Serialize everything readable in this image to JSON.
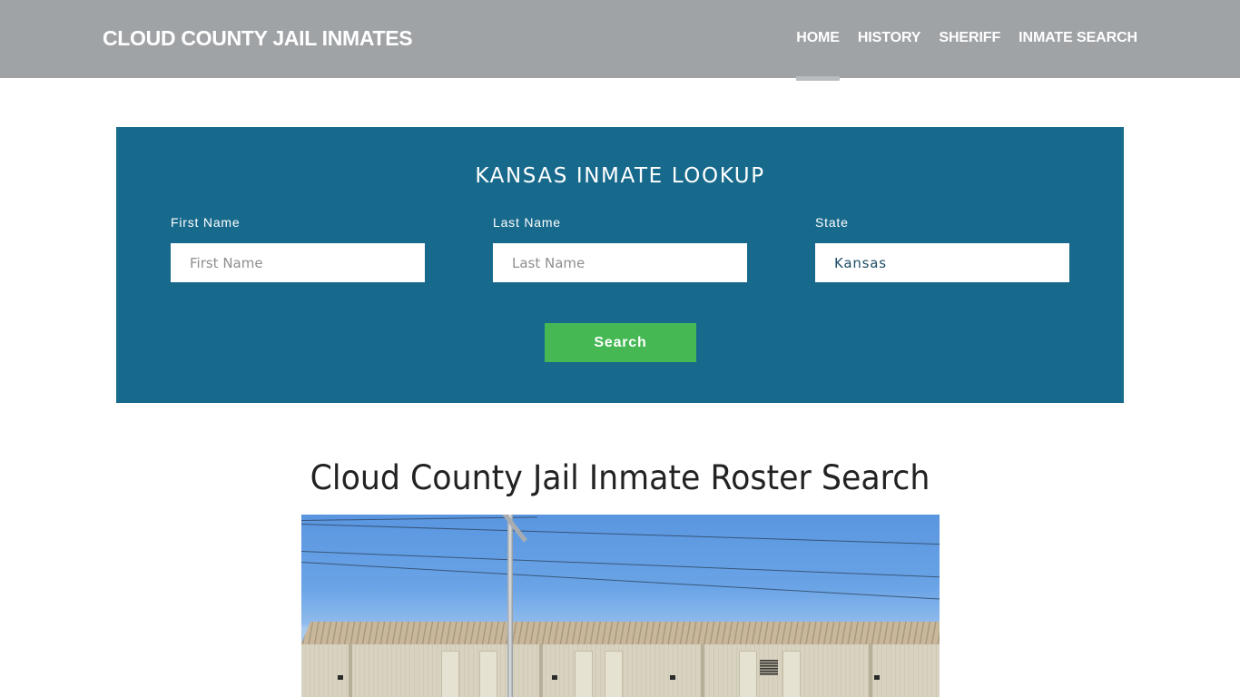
{
  "navbar": {
    "brand": "CLOUD COUNTY JAIL INMATES",
    "links": [
      {
        "label": "HOME",
        "active": true
      },
      {
        "label": "HISTORY",
        "active": false
      },
      {
        "label": "SHERIFF",
        "active": false
      },
      {
        "label": "INMATE SEARCH",
        "active": false
      }
    ]
  },
  "lookup": {
    "title": "KANSAS INMATE LOOKUP",
    "first_name": {
      "label": "First Name",
      "placeholder": "First Name",
      "value": ""
    },
    "last_name": {
      "label": "Last Name",
      "placeholder": "Last Name",
      "value": ""
    },
    "state": {
      "label": "State",
      "value": "Kansas"
    },
    "search_label": "Search"
  },
  "main": {
    "heading": "Cloud County Jail Inmate Roster Search",
    "image_alt": "Cloud County Jail building exterior"
  },
  "colors": {
    "navbar_bg": "#9fa3a6",
    "lookup_bg": "#186a8d",
    "search_button": "#45b854"
  }
}
